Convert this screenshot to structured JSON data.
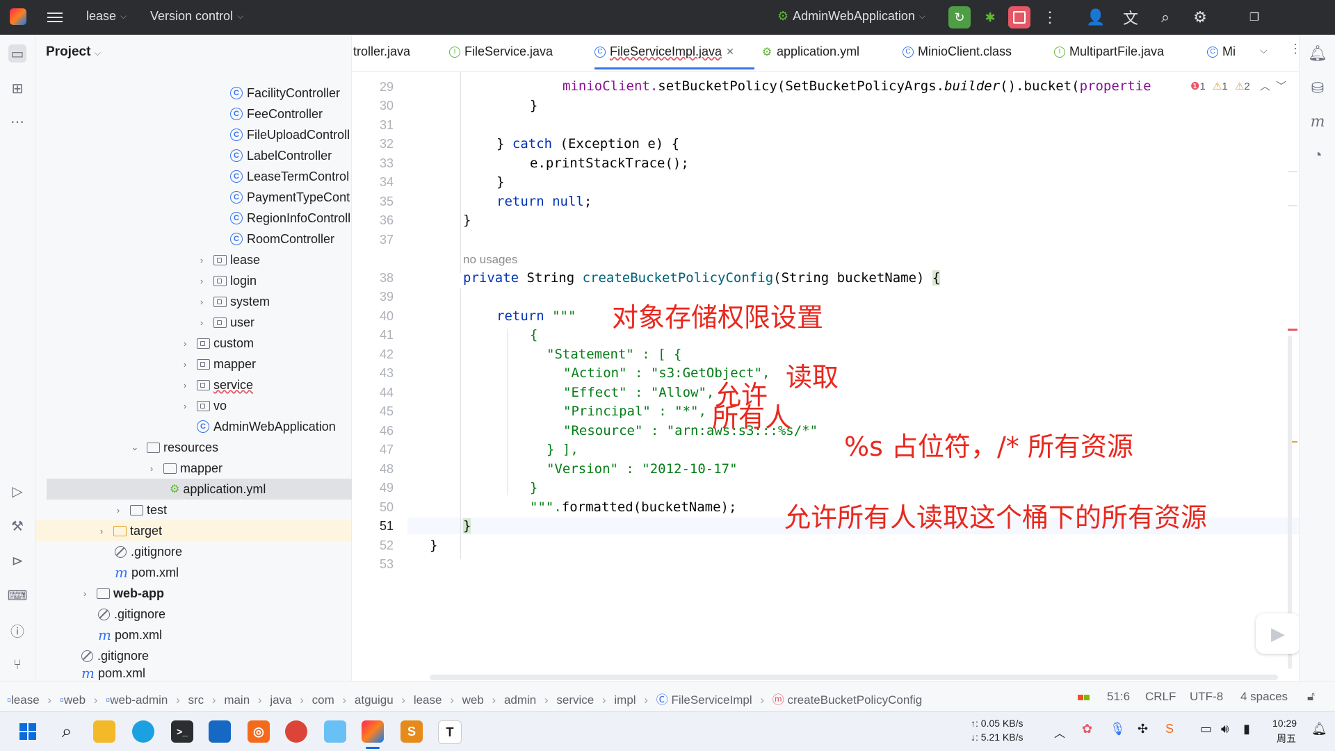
{
  "titlebar": {
    "project": "lease",
    "vcs": "Version control",
    "run_config": "AdminWebApplication"
  },
  "project_panel": {
    "title": "Project",
    "items": [
      {
        "label": "FacilityController",
        "type": "class"
      },
      {
        "label": "FeeController",
        "type": "class"
      },
      {
        "label": "FileUploadControll",
        "type": "class"
      },
      {
        "label": "LabelController",
        "type": "class"
      },
      {
        "label": "LeaseTermControl",
        "type": "class"
      },
      {
        "label": "PaymentTypeCont",
        "type": "class"
      },
      {
        "label": "RegionInfoControll",
        "type": "class"
      },
      {
        "label": "RoomController",
        "type": "class"
      },
      {
        "label": "lease",
        "type": "package"
      },
      {
        "label": "login",
        "type": "package"
      },
      {
        "label": "system",
        "type": "package"
      },
      {
        "label": "user",
        "type": "package"
      },
      {
        "label": "custom",
        "type": "package"
      },
      {
        "label": "mapper",
        "type": "package"
      },
      {
        "label": "service",
        "type": "package"
      },
      {
        "label": "vo",
        "type": "package"
      },
      {
        "label": "AdminWebApplication",
        "type": "app"
      },
      {
        "label": "resources",
        "type": "folder"
      },
      {
        "label": "mapper",
        "type": "folder"
      },
      {
        "label": "application.yml",
        "type": "yml"
      },
      {
        "label": "test",
        "type": "folder"
      },
      {
        "label": "target",
        "type": "folder"
      },
      {
        "label": ".gitignore",
        "type": "ignore"
      },
      {
        "label": "pom.xml",
        "type": "maven"
      },
      {
        "label": "web-app",
        "type": "module"
      },
      {
        "label": ".gitignore",
        "type": "ignore"
      },
      {
        "label": "pom.xml",
        "type": "maven"
      },
      {
        "label": ".gitignore",
        "type": "ignore"
      },
      {
        "label": "pom.xml",
        "type": "maven"
      }
    ]
  },
  "tabs": [
    {
      "label": "troller.java"
    },
    {
      "label": "FileService.java"
    },
    {
      "label": "FileServiceImpl.java"
    },
    {
      "label": "application.yml"
    },
    {
      "label": "MinioClient.class"
    },
    {
      "label": "MultipartFile.java"
    },
    {
      "label": "Mi"
    }
  ],
  "inspections": {
    "errors": "1",
    "warn1": "1",
    "warn2": "2"
  },
  "editor": {
    "line_numbers": [
      "29",
      "30",
      "31",
      "32",
      "33",
      "34",
      "35",
      "36",
      "37",
      "38",
      "39",
      "40",
      "41",
      "42",
      "43",
      "44",
      "45",
      "46",
      "47",
      "48",
      "49",
      "50",
      "51",
      "52",
      "53"
    ],
    "no_usages": "no usages",
    "lines": {
      "l29a": "minioClient.",
      "l29b": "setBucketPolicy",
      "l29c": "(SetBucketPolicyArgs.",
      "l29d": "builder",
      "l29e": "().",
      "l29f": "bucket",
      "l29g": "(",
      "l29h": "propertie",
      "l30": "}",
      "l32a": "} ",
      "l32b": "catch",
      "l32c": " (Exception e) {",
      "l33a": "e.",
      "l33b": "printStackTrace",
      "l33c": "();",
      "l34": "}",
      "l35a": "return",
      "l35b": " null",
      "l35c": ";",
      "l36": "}",
      "l38a": "private",
      "l38b": " String ",
      "l38c": "createBucketPolicyConfig",
      "l38d": "(String bucketName) ",
      "l38e": "{",
      "l40a": "return",
      "l40b": " \"\"\"",
      "l41": "{",
      "l42": "\"Statement\" : [ {",
      "l43": "\"Action\" : \"s3:GetObject\",",
      "l44": "\"Effect\" : \"Allow\",",
      "l45": "\"Principal\" : \"*\",",
      "l46": "\"Resource\" : \"arn:aws:s3:::%s/*\"",
      "l47": "} ],",
      "l48": "\"Version\" : \"2012-10-17\"",
      "l49": "}",
      "l50a": "\"\"\".",
      "l50b": "formatted",
      "l50c": "(bucketName);",
      "l51": "}",
      "l52": "}"
    }
  },
  "annotations": {
    "a1": "对象存储权限设置",
    "a2": "读取",
    "a3": "允许",
    "a4": "所有人",
    "a5": "%s 占位符，/* 所有资源",
    "a6": "允许所有人读取这个桶下的所有资源"
  },
  "statusbar": {
    "breadcrumbs": [
      "lease",
      "web",
      "web-admin",
      "src",
      "main",
      "java",
      "com",
      "atguigu",
      "lease",
      "web",
      "admin",
      "service",
      "impl",
      "FileServiceImpl",
      "createBucketPolicyConfig"
    ],
    "position": "51:6",
    "line_sep": "CRLF",
    "encoding": "UTF-8",
    "indent": "4 spaces"
  },
  "taskbar": {
    "net_up": "↑: 0.05 KB/s",
    "net_down": "↓: 5.21 KB/s",
    "time": "10:29",
    "day": "周五"
  },
  "colors": {
    "accent": "#3574f0",
    "annotation": "#e8281e",
    "titlebar": "#2b2d30"
  }
}
